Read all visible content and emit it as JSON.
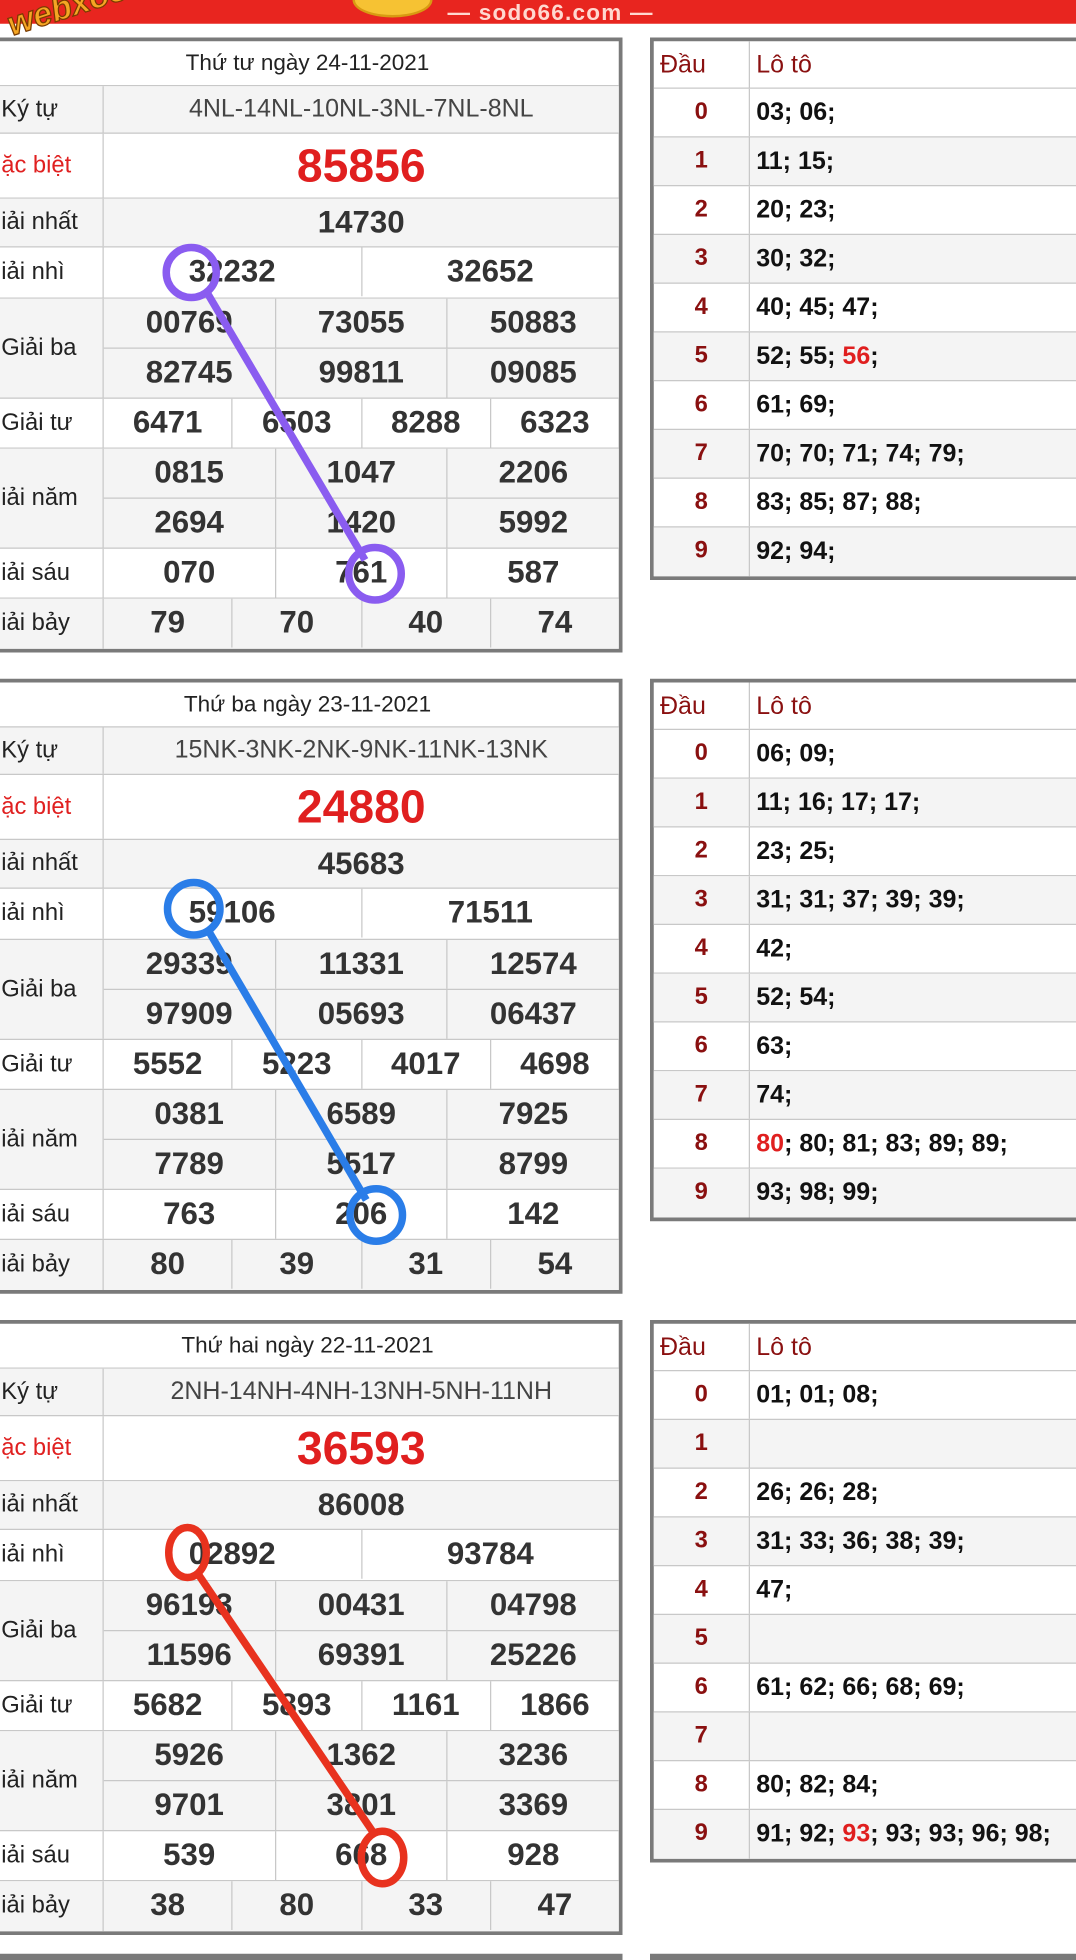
{
  "site": "— sodo66.com —",
  "watermark": "webxoso.net",
  "labels": {
    "ky_tu": "Ký tự",
    "dac_biet": "ặc biệt",
    "g1": "iải nhất",
    "g2": "iải nhì",
    "g3": "Giải ba",
    "g4": "Giải tư",
    "g5": "iải năm",
    "g6": "iải sáu",
    "g7": "iải bảy"
  },
  "lotto_header": {
    "dau": "Đầu",
    "loto": "Lô tô"
  },
  "colors": {
    "accent_red": "#e01f1f",
    "circle_purple": "#8a5cf0",
    "circle_blue": "#2a7de8",
    "circle_red": "#e8321e",
    "border_gray": "#7a7a7a"
  },
  "days": [
    {
      "date": "Thứ tư ngày 24-11-2021",
      "ky_tu": "4NL-14NL-10NL-3NL-7NL-8NL",
      "db": "85856",
      "g1": "14730",
      "g2": [
        "32232",
        "32652"
      ],
      "g3a": [
        "00769",
        "73055",
        "50883"
      ],
      "g3b": [
        "82745",
        "99811",
        "09085"
      ],
      "g4": [
        "6471",
        "6503",
        "8288",
        "6323"
      ],
      "g5a": [
        "0815",
        "1047",
        "2206"
      ],
      "g5b": [
        "2694",
        "1420",
        "5992"
      ],
      "g6": [
        "070",
        "761",
        "587"
      ],
      "g7": [
        "79",
        "70",
        "40",
        "74"
      ],
      "lotto": [
        {
          "d": "0",
          "pre": "03; 06;",
          "hl": "",
          "post": ""
        },
        {
          "d": "1",
          "pre": "11; 15;",
          "hl": "",
          "post": ""
        },
        {
          "d": "2",
          "pre": "20; 23;",
          "hl": "",
          "post": ""
        },
        {
          "d": "3",
          "pre": "30; 32;",
          "hl": "",
          "post": ""
        },
        {
          "d": "4",
          "pre": "40; 45; 47;",
          "hl": "",
          "post": ""
        },
        {
          "d": "5",
          "pre": "52; 55; ",
          "hl": "56",
          "post": ";"
        },
        {
          "d": "6",
          "pre": "61; 69;",
          "hl": "",
          "post": ""
        },
        {
          "d": "7",
          "pre": "70; 70; 71; 74; 79;",
          "hl": "",
          "post": ""
        },
        {
          "d": "8",
          "pre": "83; 85; 87; 88;",
          "hl": "",
          "post": ""
        },
        {
          "d": "9",
          "pre": "92; 94;",
          "hl": "",
          "post": ""
        }
      ]
    },
    {
      "date": "Thứ ba ngày 23-11-2021",
      "ky_tu": "15NK-3NK-2NK-9NK-11NK-13NK",
      "db": "24880",
      "g1": "45683",
      "g2": [
        "59106",
        "71511"
      ],
      "g3a": [
        "29339",
        "11331",
        "12574"
      ],
      "g3b": [
        "97909",
        "05693",
        "06437"
      ],
      "g4": [
        "5552",
        "5223",
        "4017",
        "4698"
      ],
      "g5a": [
        "0381",
        "6589",
        "7925"
      ],
      "g5b": [
        "7789",
        "5517",
        "8799"
      ],
      "g6": [
        "763",
        "206",
        "142"
      ],
      "g7": [
        "80",
        "39",
        "31",
        "54"
      ],
      "lotto": [
        {
          "d": "0",
          "pre": "06; 09;",
          "hl": "",
          "post": ""
        },
        {
          "d": "1",
          "pre": "11; 16; 17; 17;",
          "hl": "",
          "post": ""
        },
        {
          "d": "2",
          "pre": "23; 25;",
          "hl": "",
          "post": ""
        },
        {
          "d": "3",
          "pre": "31; 31; 37; 39; 39;",
          "hl": "",
          "post": ""
        },
        {
          "d": "4",
          "pre": "42;",
          "hl": "",
          "post": ""
        },
        {
          "d": "5",
          "pre": "52; 54;",
          "hl": "",
          "post": ""
        },
        {
          "d": "6",
          "pre": "63;",
          "hl": "",
          "post": ""
        },
        {
          "d": "7",
          "pre": "74;",
          "hl": "",
          "post": ""
        },
        {
          "d": "8",
          "pre": "",
          "hl": "80",
          "post": "; 80; 81; 83; 89; 89;"
        },
        {
          "d": "9",
          "pre": "93; 98; 99;",
          "hl": "",
          "post": ""
        }
      ]
    },
    {
      "date": "Thứ hai ngày 22-11-2021",
      "ky_tu": "2NH-14NH-4NH-13NH-5NH-11NH",
      "db": "36593",
      "g1": "86008",
      "g2": [
        "02892",
        "93784"
      ],
      "g3a": [
        "96193",
        "00431",
        "04798"
      ],
      "g3b": [
        "11596",
        "69391",
        "25226"
      ],
      "g4": [
        "5682",
        "5893",
        "1161",
        "1866"
      ],
      "g5a": [
        "5926",
        "1362",
        "3236"
      ],
      "g5b": [
        "9701",
        "3801",
        "3369"
      ],
      "g6": [
        "539",
        "668",
        "928"
      ],
      "g7": [
        "38",
        "80",
        "33",
        "47"
      ],
      "lotto": [
        {
          "d": "0",
          "pre": "01; 01; 08;",
          "hl": "",
          "post": ""
        },
        {
          "d": "1",
          "pre": "",
          "hl": "",
          "post": ""
        },
        {
          "d": "2",
          "pre": "26; 26; 28;",
          "hl": "",
          "post": ""
        },
        {
          "d": "3",
          "pre": "31; 33; 36; 38; 39;",
          "hl": "",
          "post": ""
        },
        {
          "d": "4",
          "pre": "47;",
          "hl": "",
          "post": ""
        },
        {
          "d": "5",
          "pre": "",
          "hl": "",
          "post": ""
        },
        {
          "d": "6",
          "pre": "61; 62; 66; 68; 69;",
          "hl": "",
          "post": ""
        },
        {
          "d": "7",
          "pre": "",
          "hl": "",
          "post": ""
        },
        {
          "d": "8",
          "pre": "80; 82; 84;",
          "hl": "",
          "post": ""
        },
        {
          "d": "9",
          "pre": "91; 92; ",
          "hl": "93",
          "post": "; 93; 93; 96; 98;"
        }
      ]
    }
  ]
}
